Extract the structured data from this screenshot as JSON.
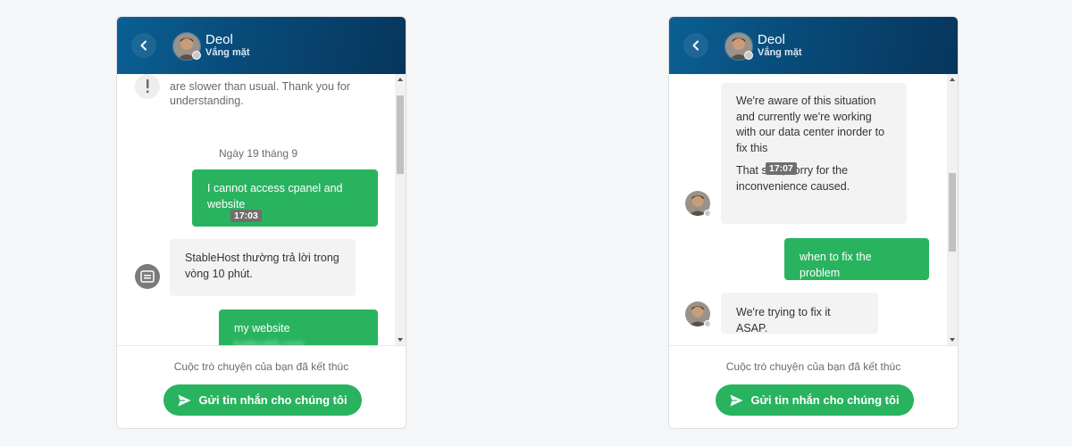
{
  "colors": {
    "header_gradient_start": "#0b5f93",
    "header_gradient_end": "#07365c",
    "accent_green": "#29b35f",
    "incoming_bubble": "#f3f3f3",
    "time_chip": "#6f6f6f",
    "page_background": "#f5f6f8"
  },
  "left_widget": {
    "header": {
      "back_icon": "chevron-left-icon",
      "agent_name": "Deol",
      "agent_status": "Vắng mặt"
    },
    "messages": {
      "system_notice": {
        "icon": "exclamation-icon",
        "line1": "are slower than usual. Thank you for",
        "line2": "understanding."
      },
      "date_separator": "Ngày 19 tháng 9",
      "user_message_1": {
        "line1": "I cannot access cpanel and",
        "line2": "website",
        "time": "17:03"
      },
      "bot_message": {
        "icon": "chat-bot-icon",
        "line1": "StableHost thường trả lời trong",
        "line2": "vòng 10 phút."
      },
      "user_message_2": {
        "text": "my website",
        "blurred": "tuahuyhb.com"
      }
    },
    "footer": {
      "ended_note": "Cuộc trò chuyện của bạn đã kết thúc",
      "send_label": "Gửi tin nhắn cho chúng tôi",
      "send_icon": "paper-plane-icon"
    },
    "scrollbar_position": 0.12
  },
  "right_widget": {
    "header": {
      "back_icon": "chevron-left-icon",
      "agent_name": "Deol",
      "agent_status": "Vắng mặt"
    },
    "messages": {
      "agent_message_1": {
        "line1": "We're aware of this situation",
        "line2": "and currently we're working",
        "line3": "with our data center inorder to",
        "line4": "fix this",
        "time": "17:07",
        "line5": "That said, sorry for the",
        "line6": "inconvenience caused."
      },
      "user_message": {
        "text": "when to fix the problem"
      },
      "agent_message_2": {
        "text": "We're trying to fix it ASAP."
      }
    },
    "footer": {
      "ended_note": "Cuộc trò chuyện của bạn đã kết thúc",
      "send_label": "Gửi tin nhắn cho chúng tôi",
      "send_icon": "paper-plane-icon"
    },
    "scrollbar_position": 0.4
  }
}
